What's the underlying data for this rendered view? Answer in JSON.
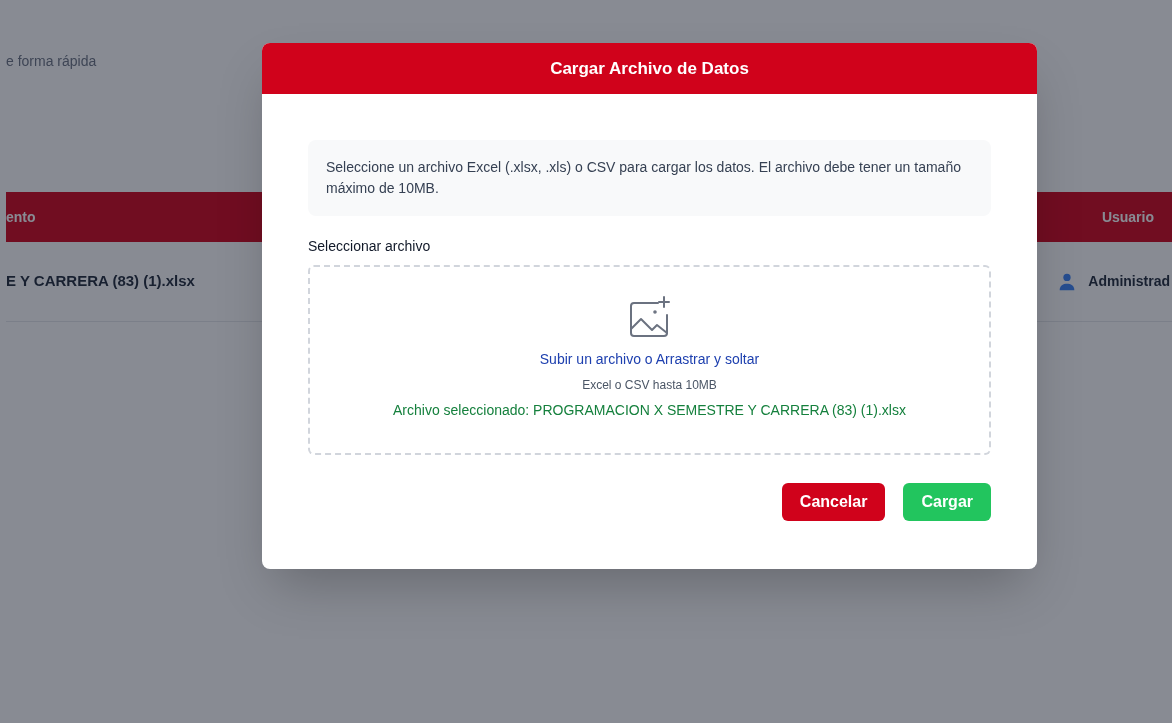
{
  "page": {
    "subtitle": "e forma rápida"
  },
  "table": {
    "columns": [
      "ento",
      "Usuario"
    ],
    "rows": [
      {
        "cells": [
          "E Y CARRERA (83) (1).xlsx",
          "Administrad"
        ]
      }
    ]
  },
  "dialog": {
    "title": "Cargar Archivo de Datos",
    "info": "Seleccione un archivo Excel (.xlsx, .xls) o CSV para cargar los datos. El archivo debe tener un tamaño máximo de 10MB.",
    "field_label": "Seleccionar archivo",
    "dropzone": {
      "link": "Subir un archivo o Arrastrar y soltar",
      "hint": "Excel o CSV hasta 10MB",
      "selected_file": "Archivo seleccionado: PROGRAMACION X SEMESTRE Y CARRERA (83) (1).xlsx"
    },
    "buttons": [
      {
        "label": "Cancelar",
        "kind": "cancel"
      },
      {
        "label": "Cargar",
        "kind": "submit"
      }
    ]
  }
}
